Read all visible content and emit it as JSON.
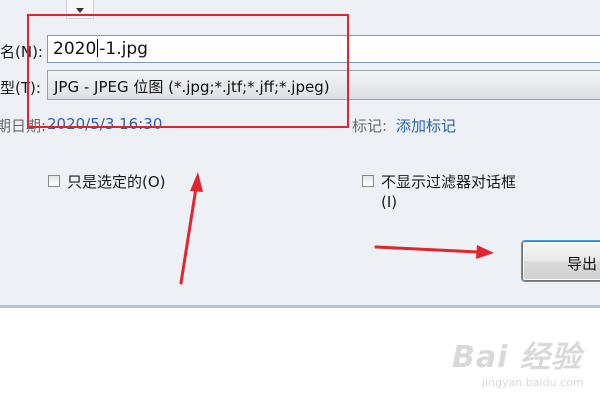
{
  "form": {
    "filename_label": "名(N):",
    "filename_value_a": "2020",
    "filename_value_b": "-1.jpg",
    "filetype_label": "型(T):",
    "filetype_value": "JPG - JPEG 位图 (*.jpg;*.jtf;*.jff;*.jpeg)",
    "date_label": "期日期:",
    "date_value": "2020/5/3 16:30",
    "tags_label": "标记:",
    "tags_link": "添加标记"
  },
  "options": {
    "only_selected": "只是选定的(O)",
    "no_filter_dialog_line1": "不显示过滤器对话框",
    "no_filter_dialog_line2": "(I)"
  },
  "buttons": {
    "export": "导出"
  },
  "watermark": {
    "logo": "Bai 经验",
    "url": "jingyan.baidu.com"
  },
  "colors": {
    "annotation": "#e0252e",
    "link": "#2a63b0",
    "dialog_bg": "#edf1f6"
  }
}
